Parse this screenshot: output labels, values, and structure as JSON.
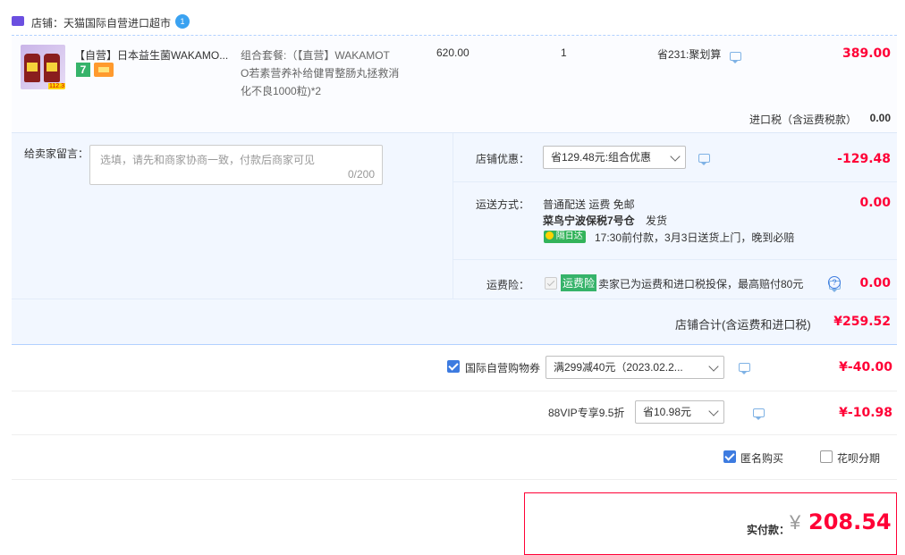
{
  "shop": {
    "label": "店铺：天猫国际自营进口超市",
    "badge": "1"
  },
  "item": {
    "title": "【自营】日本益生菌WAKAMO...",
    "badge_number": "7",
    "set_desc_1": "组合套餐:（【直营】WAKAMOT",
    "set_desc_2": "O若素营养补给健胃整肠丸拯救消",
    "set_desc_3": "化不良1000粒)*2",
    "unit_price": "620.00",
    "quantity": "1",
    "promo": "省231:聚划算",
    "subtotal": "389.00",
    "thumb_tag": "112.3"
  },
  "import_tax": {
    "label": "进口税（含运费税款）",
    "value": "0.00"
  },
  "message": {
    "label": "给卖家留言：",
    "placeholder": "选填，请先和商家协商一致，付款后商家可见",
    "counter": "0/200"
  },
  "shop_discount": {
    "label": "店铺优惠：",
    "selected": "省129.48元:组合优惠",
    "value": "-129.48"
  },
  "shipping": {
    "label": "运送方式：",
    "line1": "普通配送 运费 免邮",
    "warehouse": "菜鸟宁波保税7号仓",
    "ship_text": "发货",
    "badge": "隔日达",
    "eta": "17:30前付款，3月3日送货上门，晚到必赔",
    "value": "0.00"
  },
  "insurance": {
    "label": "运费险：",
    "badge": "运费险",
    "text": "卖家已为运费和进口税投保，最高赔付80元",
    "value": "0.00"
  },
  "shop_total": {
    "label": "店铺合计(含运费和进口税)",
    "value": "¥259.52"
  },
  "coupon": {
    "label": "国际自营购物券",
    "selected": "满299减40元（2023.02.2...",
    "value": "¥-40.00"
  },
  "vip": {
    "label": "88VIP专享9.5折",
    "selected": "省10.98元",
    "value": "¥-10.98"
  },
  "options": {
    "anonymous": "匿名购买",
    "installment": "花呗分期"
  },
  "payment": {
    "label": "实付款：",
    "currency": "¥",
    "amount": "208.54"
  },
  "colors": {
    "accent": "#ff0036",
    "panel": "#f2f7ff",
    "border": "#b2d1ff",
    "check": "#3d7be0"
  }
}
